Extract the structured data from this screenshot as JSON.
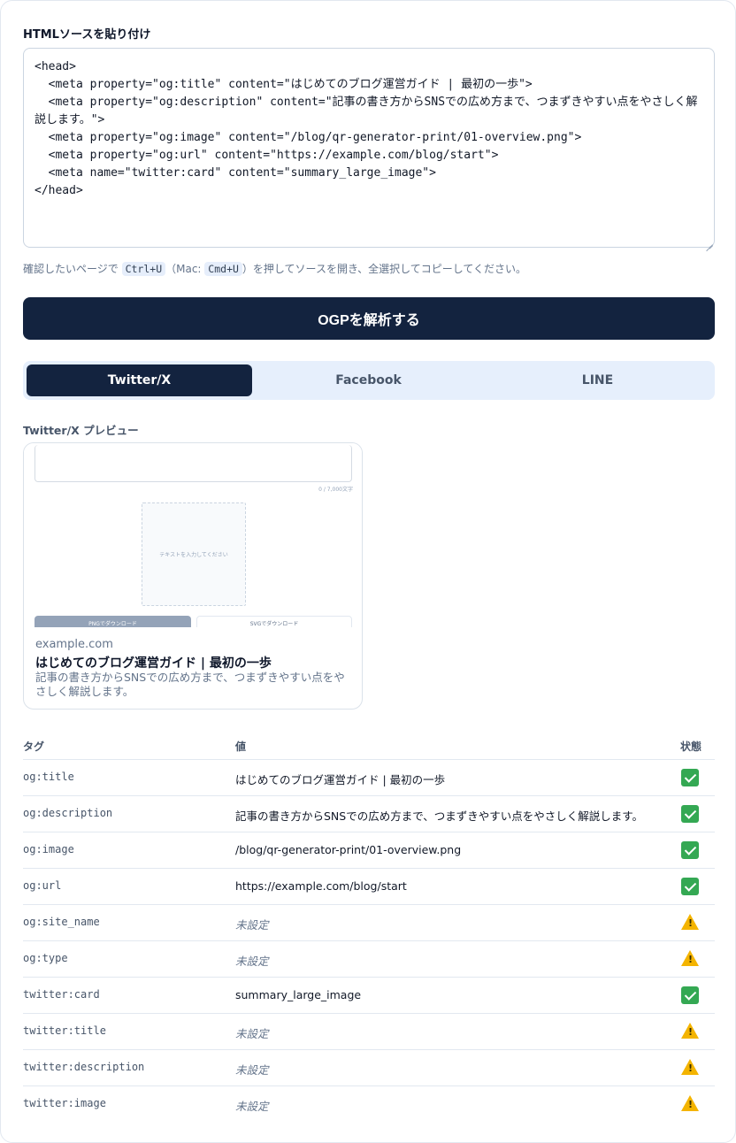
{
  "source": {
    "label": "HTMLソースを貼り付け",
    "value": "<head>\n  <meta property=\"og:title\" content=\"はじめてのブログ運営ガイド | 最初の一歩\">\n  <meta property=\"og:description\" content=\"記事の書き方からSNSでの広め方まで、つまずきやすい点をやさしく解説します。\">\n  <meta property=\"og:image\" content=\"/blog/qr-generator-print/01-overview.png\">\n  <meta property=\"og:url\" content=\"https://example.com/blog/start\">\n  <meta name=\"twitter:card\" content=\"summary_large_image\">\n</head>"
  },
  "hint": {
    "before": "確認したいページで ",
    "key1": "Ctrl+U",
    "mid1": "（Mac: ",
    "key2": "Cmd+U",
    "after": "）を押してソースを開き、全選択してコピーしてください。"
  },
  "parse_button": "OGPを解析する",
  "tabs": [
    {
      "label": "Twitter/X",
      "active": true
    },
    {
      "label": "Facebook",
      "active": false
    },
    {
      "label": "LINE",
      "active": false
    }
  ],
  "preview": {
    "label": "Twitter/X プレビュー",
    "image": {
      "counter": "0 / 7,000文字",
      "qr_placeholder": "テキストを入力してください",
      "png_button": "PNGでダウンロード",
      "svg_button": "SVGでダウンロード"
    },
    "domain": "example.com",
    "title": "はじめてのブログ運営ガイド | 最初の一歩",
    "description": "記事の書き方からSNSでの広め方まで、つまずきやすい点をやさしく解説します。"
  },
  "table": {
    "headers": {
      "tag": "タグ",
      "value": "値",
      "status": "状態"
    },
    "rows": [
      {
        "tag": "og:title",
        "value": "はじめてのブログ運営ガイド | 最初の一歩",
        "status": "ok-icon"
      },
      {
        "tag": "og:description",
        "value": "記事の書き方からSNSでの広め方まで、つまずきやすい点をやさしく解説します。",
        "status": "ok-icon"
      },
      {
        "tag": "og:image",
        "value": "/blog/qr-generator-print/01-overview.png",
        "status": "ok-icon"
      },
      {
        "tag": "og:url",
        "value": "https://example.com/blog/start",
        "status": "ok-icon"
      },
      {
        "tag": "og:site_name",
        "value": "未設定",
        "status": "warning-icon"
      },
      {
        "tag": "og:type",
        "value": "未設定",
        "status": "warning-icon"
      },
      {
        "tag": "twitter:card",
        "value": "summary_large_image",
        "status": "ok-icon"
      },
      {
        "tag": "twitter:title",
        "value": "未設定",
        "status": "warning-icon"
      },
      {
        "tag": "twitter:description",
        "value": "未設定",
        "status": "warning-icon"
      },
      {
        "tag": "twitter:image",
        "value": "未設定",
        "status": "warning-icon"
      }
    ]
  },
  "colors": {
    "primary": "#13233f",
    "tab_bg": "#e6effc",
    "ok": "#34a853",
    "warning": "#f4b400"
  }
}
